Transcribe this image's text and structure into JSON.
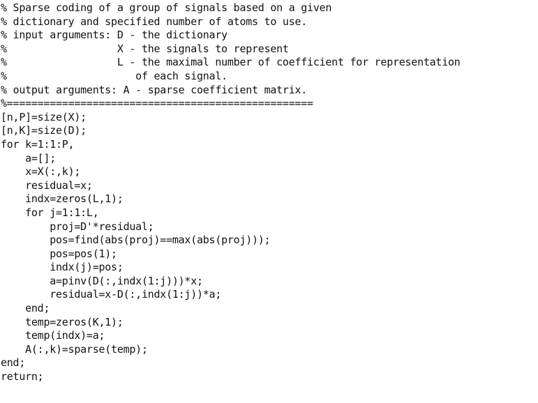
{
  "document": {
    "kind": "source-code-listing",
    "language": "MATLAB",
    "background_color": "#ffffff",
    "text_color": "#111111",
    "lines": [
      "% Sparse coding of a group of signals based on a given",
      "% dictionary and specified number of atoms to use.",
      "% input arguments: D - the dictionary",
      "%                  X - the signals to represent",
      "%                  L - the maximal number of coefficient for representation",
      "%                     of each signal.",
      "% output arguments: A - sparse coefficient matrix.",
      "%==================================================",
      "[n,P]=size(X);",
      "[n,K]=size(D);",
      "for k=1:1:P,",
      "    a=[];",
      "    x=X(:,k);",
      "    residual=x;",
      "    indx=zeros(L,1);",
      "    for j=1:1:L,",
      "        proj=D'*residual;",
      "        pos=find(abs(proj)==max(abs(proj)));",
      "        pos=pos(1);",
      "        indx(j)=pos;",
      "        a=pinv(D(:,indx(1:j)))*x;",
      "        residual=x-D(:,indx(1:j))*a;",
      "    end;",
      "    temp=zeros(K,1);",
      "    temp(indx)=a;",
      "    A(:,k)=sparse(temp);",
      "end;",
      "return;"
    ]
  }
}
